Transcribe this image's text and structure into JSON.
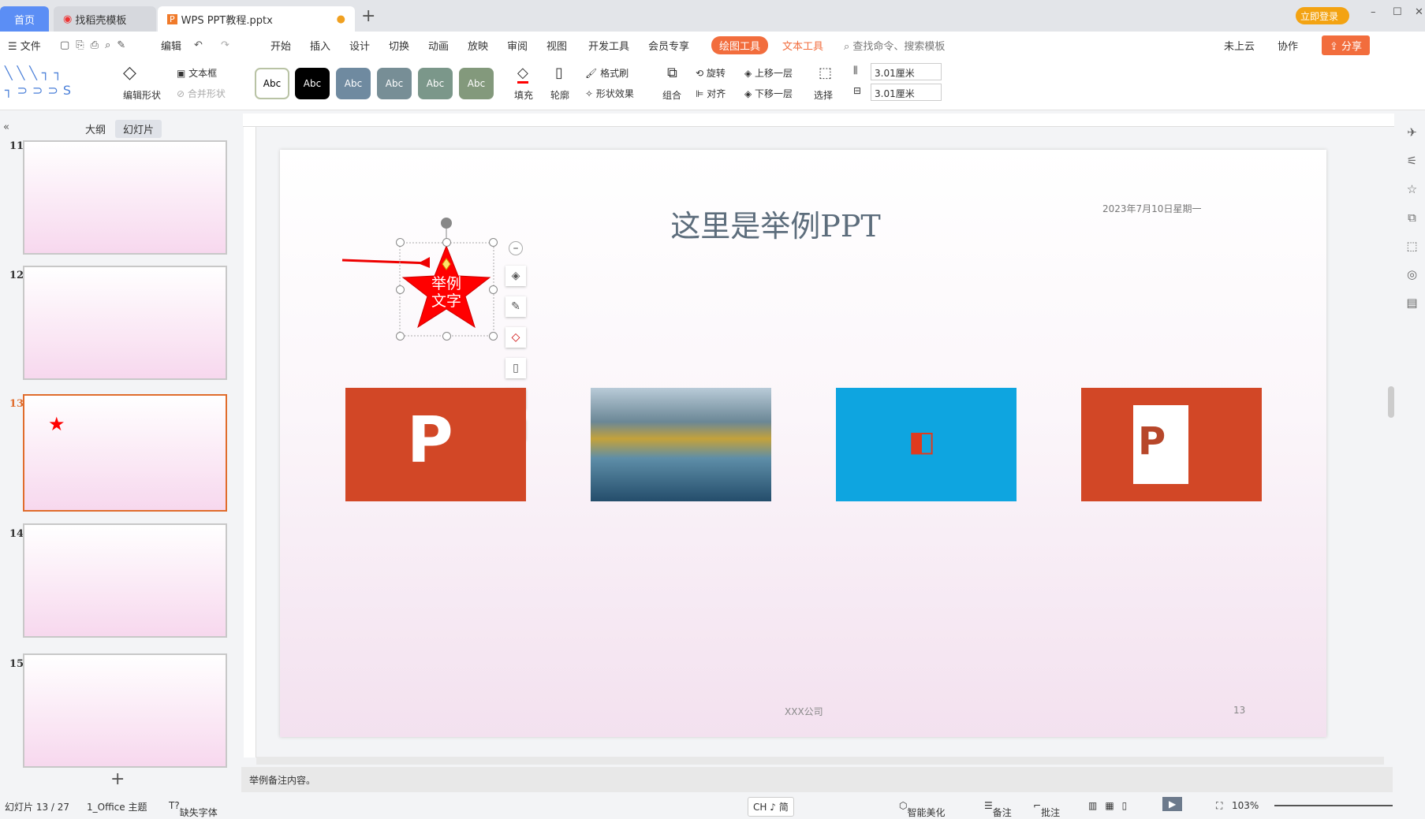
{
  "tabs": [
    {
      "label": "首页"
    },
    {
      "label": "找稻壳模板"
    },
    {
      "label": "WPS PPT教程.pptx"
    }
  ],
  "titlebar": {
    "login": "立即登录",
    "new_tab": "+"
  },
  "menu": {
    "file": "文件",
    "edit": "编辑",
    "items": [
      "开始",
      "插入",
      "设计",
      "切换",
      "动画",
      "放映",
      "审阅",
      "视图",
      "开发工具",
      "会员专享"
    ],
    "drawing_tools": "绘图工具",
    "text_tools": "文本工具",
    "search": "查找命令、搜索模板",
    "cloud": "未上云",
    "collab": "协作",
    "share": "分享"
  },
  "ribbon": {
    "edit_shape": "编辑形状",
    "textbox": "文本框",
    "merge_shape": "合并形状",
    "style_label": "Abc",
    "fill": "填充",
    "outline": "轮廓",
    "format_painter": "格式刷",
    "shape_effect": "形状效果",
    "group": "组合",
    "rotate": "旋转",
    "align": "对齐",
    "bring_forward": "上移一层",
    "send_backward": "下移一层",
    "select": "选择",
    "height": "3.01厘米",
    "width": "3.01厘米"
  },
  "panel": {
    "outline_tab": "大纲",
    "slides_tab": "幻灯片",
    "slides": [
      {
        "num": "11"
      },
      {
        "num": "12"
      },
      {
        "num": "13"
      },
      {
        "num": "14"
      },
      {
        "num": "15"
      }
    ],
    "add": "+"
  },
  "slide": {
    "title": "这里是举例PPT",
    "date": "2023年7月10日星期一",
    "star_text1": "举例",
    "star_text2": "文字",
    "company": "XXX公司",
    "page": "13"
  },
  "notes": "举例备注内容。",
  "status": {
    "slide_count": "幻灯片 13 / 27",
    "theme": "1_Office 主题",
    "missing_font": "缺失字体",
    "ime": "CH ♪ 简",
    "beautify": "智能美化",
    "notes": "备注",
    "comment": "批注",
    "zoom": "103%"
  },
  "colors": {
    "accent": "#f26d3d",
    "selected": "#e06c2c",
    "star": "#ff0000"
  }
}
